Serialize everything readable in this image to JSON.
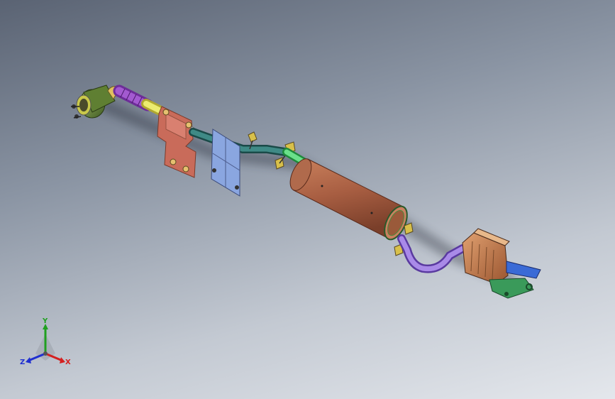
{
  "viewport": {
    "background_top": "#5a6373",
    "background_bottom": "#e4e7ec"
  },
  "model": {
    "component_colors": {
      "catalytic_converter": "#6a8a3a",
      "flex_pipe": "#8b3fb5",
      "joint": "#d8d84a",
      "heat_shield": "#c96b5a",
      "mount_plate": "#7e9ad6",
      "intermediate_pipe": "#2f6b68",
      "connector": "#4ad86a",
      "muffler": "#b2694a",
      "tailpipe": "#8a6ad6",
      "rear_muffler": "#c47a4a",
      "bracket": "#2f7a4a",
      "tip": "#3a6ad6"
    }
  },
  "triad": {
    "y_label": "Y",
    "x_label": "X",
    "z_label": "Z",
    "x_color": "#d42020",
    "y_color": "#20a020",
    "z_color": "#2030d0"
  }
}
